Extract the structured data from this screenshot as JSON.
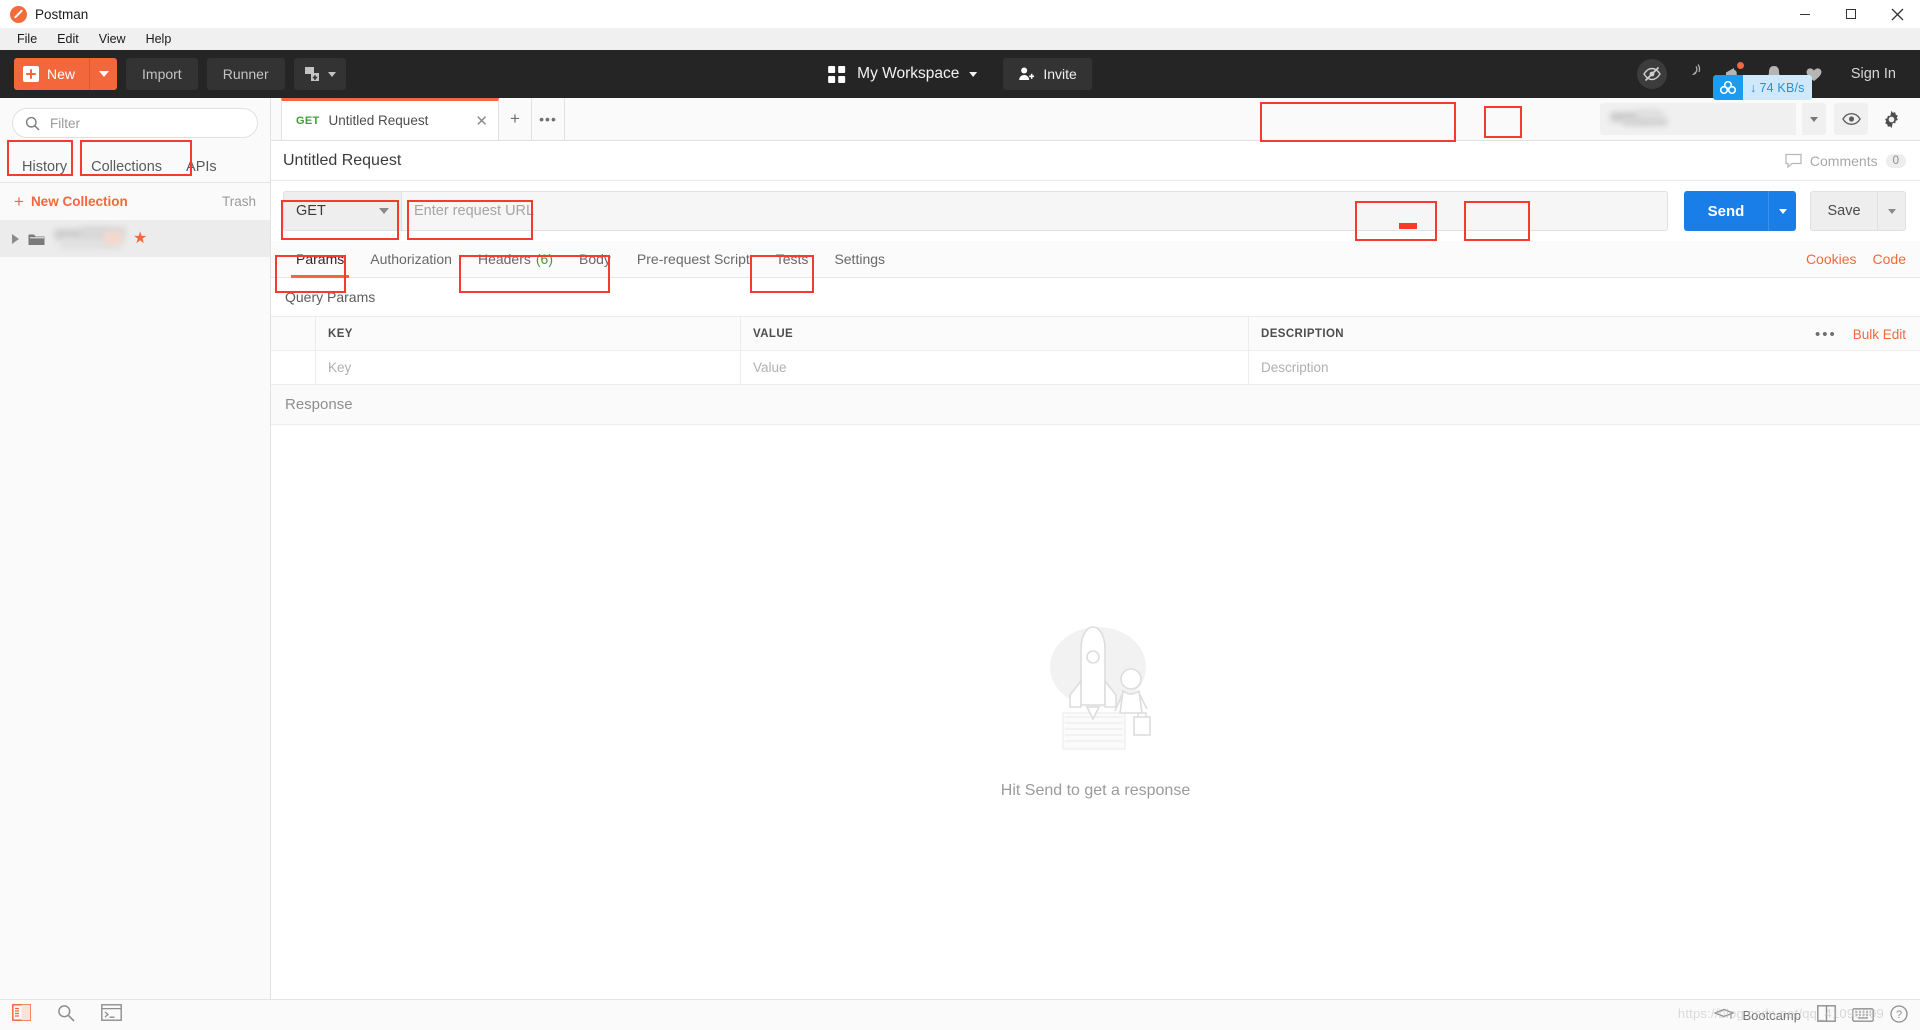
{
  "window": {
    "title": "Postman",
    "minimize": "–",
    "maximize": "❐",
    "close": "✕"
  },
  "menubar": {
    "items": [
      "File",
      "Edit",
      "View",
      "Help"
    ]
  },
  "toolbar": {
    "new_label": "New",
    "import_label": "Import",
    "runner_label": "Runner",
    "workspace_label": "My Workspace",
    "invite_label": "Invite",
    "signin_label": "Sign In",
    "network_speed": "74 KB/s",
    "network_arrow": "↓"
  },
  "sidebar": {
    "filter_placeholder": "Filter",
    "tabs": [
      {
        "label": "History",
        "highlighted": true
      },
      {
        "label": "Collections",
        "highlighted": true
      },
      {
        "label": "APIs",
        "highlighted": false
      }
    ],
    "new_collection_label": "New Collection",
    "new_collection_plus": "+",
    "trash_label": "Trash",
    "collection_row": {
      "name_redacted": true,
      "starred": true,
      "star_glyph": "★"
    }
  },
  "tabstrip": {
    "request_tab": {
      "method": "GET",
      "title": "Untitled Request",
      "close_glyph": "✕"
    },
    "add_tab_glyph": "+",
    "more_tabs_glyph": "•••",
    "environment": {
      "value_redacted": true,
      "placeholder": ""
    }
  },
  "request": {
    "title": "Untitled Request",
    "comments_label": "Comments",
    "comments_count": "0",
    "method": "GET",
    "url_placeholder": "Enter request URL",
    "send_label": "Send",
    "save_label": "Save",
    "tabs": [
      {
        "label": "Params",
        "active": true,
        "highlighted": true
      },
      {
        "label": "Authorization",
        "active": false,
        "highlighted": false
      },
      {
        "label": "Headers",
        "count": "(6)",
        "active": false,
        "highlighted": true
      },
      {
        "label": "Body",
        "active": false,
        "highlighted": true
      },
      {
        "label": "Pre-request Script",
        "active": false,
        "highlighted": false
      },
      {
        "label": "Tests",
        "active": false,
        "highlighted": true
      },
      {
        "label": "Settings",
        "active": false,
        "highlighted": false
      }
    ],
    "links": [
      "Cookies",
      "Code"
    ]
  },
  "query_params": {
    "section_title": "Query Params",
    "columns": [
      "KEY",
      "VALUE",
      "DESCRIPTION"
    ],
    "rows": [
      {
        "key": "Key",
        "value": "Value",
        "description": "Description"
      }
    ],
    "more_glyph": "•••",
    "bulk_edit_label": "Bulk Edit"
  },
  "response": {
    "title": "Response",
    "empty_hint": "Hit Send to get a response"
  },
  "statusbar": {
    "bootcamp_label": "Bootcamp",
    "help_glyph": "?",
    "watermark": "https://blog.csdn.net/qq_41099999"
  },
  "colors": {
    "accent_orange": "#f2683c",
    "send_blue": "#1a7ee8",
    "method_green": "#3fa037",
    "annotation_red": "#f53b2e",
    "toolbar_dark": "#252525"
  }
}
